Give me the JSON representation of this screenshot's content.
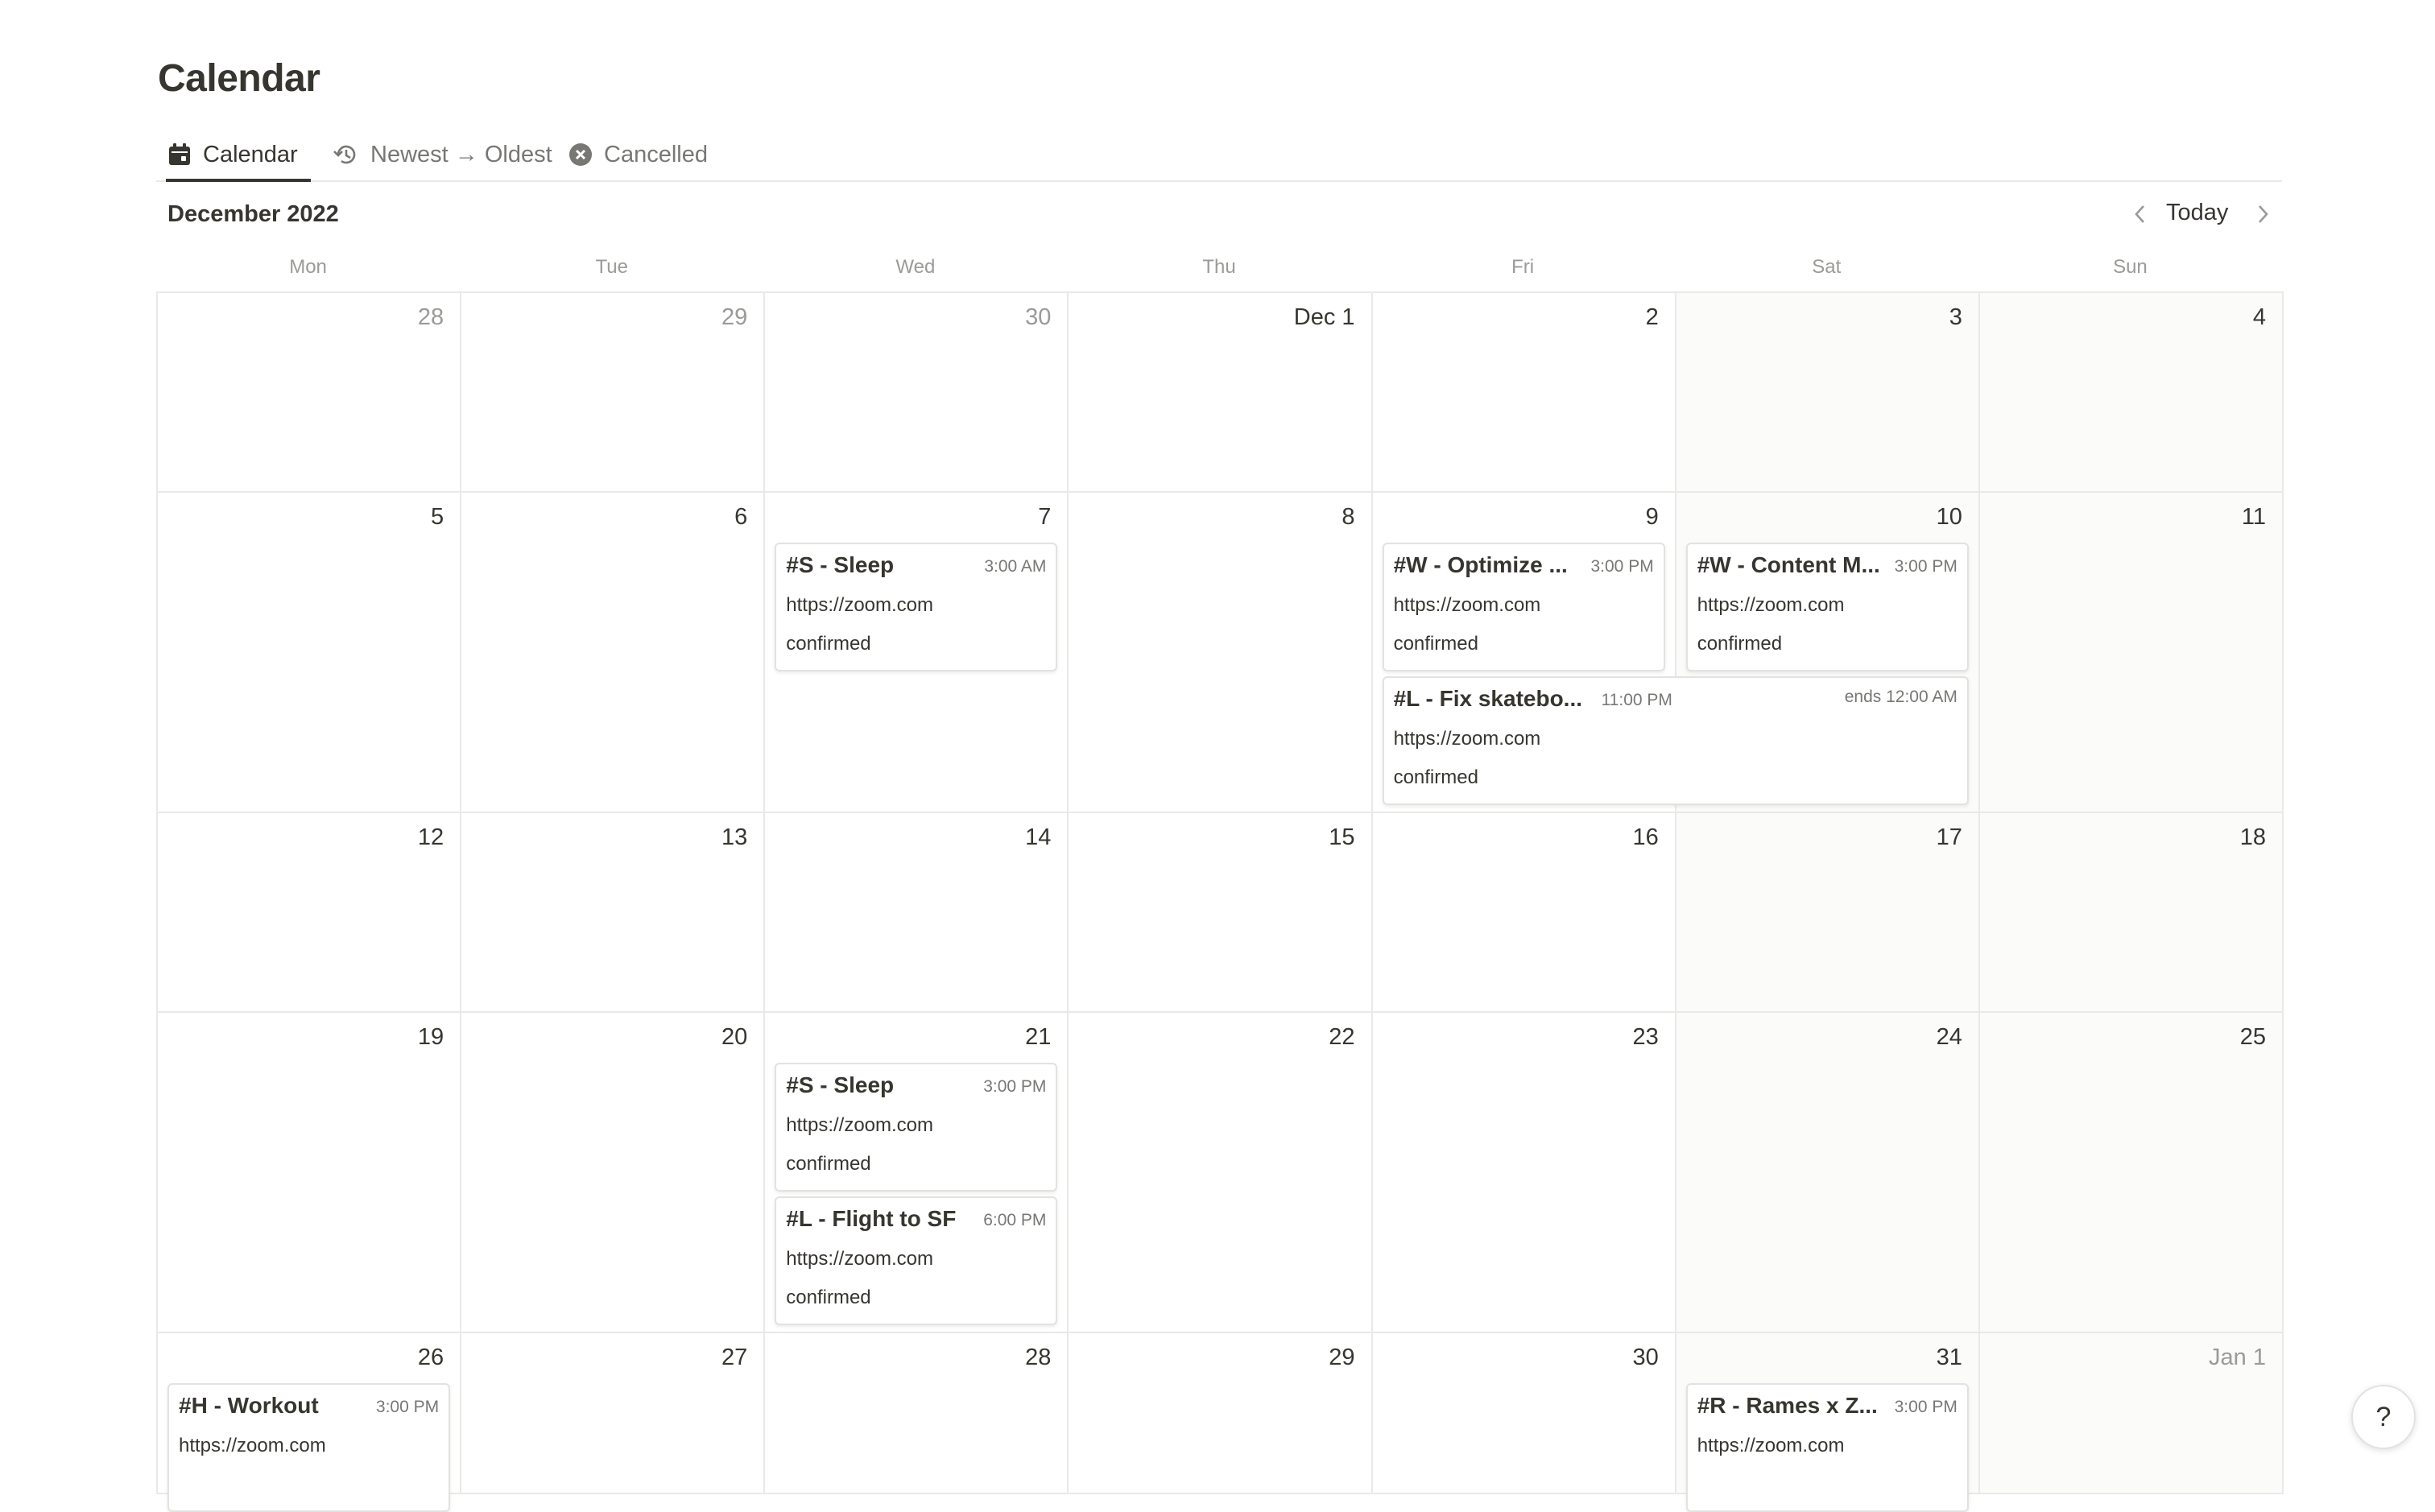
{
  "page": {
    "title": "Calendar"
  },
  "tabs": [
    {
      "label": "Calendar",
      "icon": "calendar-icon"
    },
    {
      "label": "Newest → Oldest",
      "icon": "history-icon"
    },
    {
      "label": "Cancelled",
      "icon": "x-circle-icon"
    }
  ],
  "header": {
    "month": "December 2022",
    "today_label": "Today",
    "prev_icon": "chevron-left-icon",
    "next_icon": "chevron-right-icon"
  },
  "weekdays": [
    "Mon",
    "Tue",
    "Wed",
    "Thu",
    "Fri",
    "Sat",
    "Sun"
  ],
  "weeks": [
    {
      "days": [
        {
          "label": "28",
          "muted": true
        },
        {
          "label": "29",
          "muted": true
        },
        {
          "label": "30",
          "muted": true
        },
        {
          "label": "Dec 1"
        },
        {
          "label": "2"
        },
        {
          "label": "3"
        },
        {
          "label": "4"
        }
      ]
    },
    {
      "days": [
        {
          "label": "5"
        },
        {
          "label": "6"
        },
        {
          "label": "7"
        },
        {
          "label": "8"
        },
        {
          "label": "9"
        },
        {
          "label": "10"
        },
        {
          "label": "11"
        }
      ]
    },
    {
      "days": [
        {
          "label": "12"
        },
        {
          "label": "13"
        },
        {
          "label": "14"
        },
        {
          "label": "15"
        },
        {
          "label": "16"
        },
        {
          "label": "17"
        },
        {
          "label": "18"
        }
      ]
    },
    {
      "days": [
        {
          "label": "19"
        },
        {
          "label": "20"
        },
        {
          "label": "21"
        },
        {
          "label": "22"
        },
        {
          "label": "23"
        },
        {
          "label": "24"
        },
        {
          "label": "25"
        }
      ]
    },
    {
      "days": [
        {
          "label": "26"
        },
        {
          "label": "27"
        },
        {
          "label": "28"
        },
        {
          "label": "29"
        },
        {
          "label": "30"
        },
        {
          "label": "31"
        },
        {
          "label": "Jan 1",
          "muted": true
        }
      ]
    }
  ],
  "events": [
    {
      "week": 1,
      "day": 2,
      "span": 1,
      "slot": 0,
      "title": "#S - Sleep",
      "time": "3:00 AM",
      "url": "https://zoom.com",
      "status": "confirmed"
    },
    {
      "week": 1,
      "day": 4,
      "span": 1,
      "slot": 0,
      "title": "#W - Optimize ...",
      "time": "3:00 PM",
      "url": "https://zoom.com",
      "status": "confirmed"
    },
    {
      "week": 1,
      "day": 5,
      "span": 1,
      "slot": 0,
      "title": "#W - Content M...",
      "time": "3:00 PM",
      "url": "https://zoom.com",
      "status": "confirmed"
    },
    {
      "week": 1,
      "day": 4,
      "span": 2,
      "slot": 1,
      "title": "#L - Fix skatebo...",
      "time": "11:00 PM",
      "ends": "ends 12:00 AM",
      "url": "https://zoom.com",
      "status": "confirmed"
    },
    {
      "week": 3,
      "day": 2,
      "span": 1,
      "slot": 0,
      "title": "#S - Sleep",
      "time": "3:00 PM",
      "url": "https://zoom.com",
      "status": "confirmed"
    },
    {
      "week": 3,
      "day": 2,
      "span": 1,
      "slot": 1,
      "title": "#L - Flight to SF",
      "time": "6:00 PM",
      "url": "https://zoom.com",
      "status": "confirmed"
    },
    {
      "week": 4,
      "day": 0,
      "span": 1,
      "slot": 0,
      "title": "#H - Workout",
      "time": "3:00 PM",
      "url": "https://zoom.com",
      "status": ""
    },
    {
      "week": 4,
      "day": 5,
      "span": 1,
      "slot": 0,
      "title": "#R - Rames x Z...",
      "time": "3:00 PM",
      "url": "https://zoom.com",
      "status": ""
    }
  ],
  "help": {
    "label": "?"
  }
}
